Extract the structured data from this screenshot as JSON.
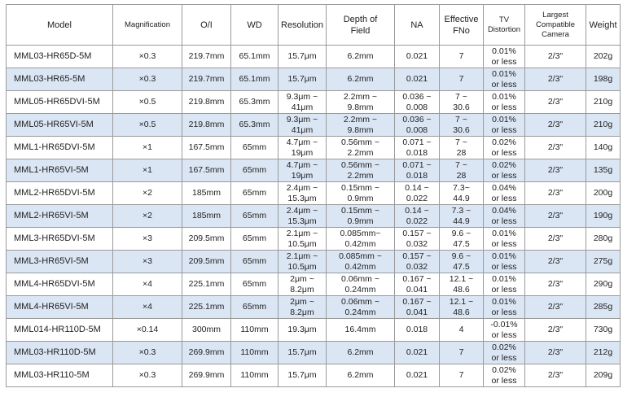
{
  "headers": {
    "model": "Model",
    "magnification": "Magnification",
    "oi": "O/I",
    "wd": "WD",
    "resolution": "Resolution",
    "dof": "Depth of\nField",
    "na": "NA",
    "fno": "Effective\nFNo",
    "tv": "TV\nDistortion",
    "camera": "Largest\nCompatible\nCamera",
    "weight": "Weight"
  },
  "rows": [
    {
      "model": "MML03-HR65D-5M",
      "mag": "×0.3",
      "oi": "219.7mm",
      "wd": "65.1mm",
      "res": "15.7μm",
      "dof": "6.2mm",
      "na": "0.021",
      "fno": "7",
      "tv": "0.01%\nor less",
      "cam": "2/3\"",
      "wt": "202g"
    },
    {
      "model": "MML03-HR65-5M",
      "mag": "×0.3",
      "oi": "219.7mm",
      "wd": "65.1mm",
      "res": "15.7μm",
      "dof": "6.2mm",
      "na": "0.021",
      "fno": "7",
      "tv": "0.01%\nor less",
      "cam": "2/3\"",
      "wt": "198g"
    },
    {
      "model": "MML05-HR65DVI-5M",
      "mag": "×0.5",
      "oi": "219.8mm",
      "wd": "65.3mm",
      "res": "9.3μm ~\n41μm",
      "dof": "2.2mm ~\n9.8mm",
      "na": "0.036 ~\n0.008",
      "fno": "7 ~\n30.6",
      "tv": "0.01%\nor less",
      "cam": "2/3\"",
      "wt": "210g"
    },
    {
      "model": "MML05-HR65VI-5M",
      "mag": "×0.5",
      "oi": "219.8mm",
      "wd": "65.3mm",
      "res": "9.3μm ~\n41μm",
      "dof": "2.2mm ~\n9.8mm",
      "na": "0.036 ~\n0.008",
      "fno": "7 ~\n30.6",
      "tv": "0.01%\nor less",
      "cam": "2/3\"",
      "wt": "210g"
    },
    {
      "model": "MML1-HR65DVI-5M",
      "mag": "×1",
      "oi": "167.5mm",
      "wd": "65mm",
      "res": "4.7μm ~\n19μm",
      "dof": "0.56mm ~\n2.2mm",
      "na": "0.071 ~\n0.018",
      "fno": "7 ~\n28",
      "tv": "0.02%\nor less",
      "cam": "2/3\"",
      "wt": "140g"
    },
    {
      "model": "MML1-HR65VI-5M",
      "mag": "×1",
      "oi": "167.5mm",
      "wd": "65mm",
      "res": "4.7μm ~\n19μm",
      "dof": "0.56mm ~\n2.2mm",
      "na": "0.071 ~\n0.018",
      "fno": "7 ~\n28",
      "tv": "0.02%\nor less",
      "cam": "2/3\"",
      "wt": "135g"
    },
    {
      "model": "MML2-HR65DVI-5M",
      "mag": "×2",
      "oi": "185mm",
      "wd": "65mm",
      "res": "2.4μm ~\n15.3μm",
      "dof": "0.15mm ~\n0.9mm",
      "na": "0.14 ~\n0.022",
      "fno": "7.3~\n44.9",
      "tv": "0.04%\nor less",
      "cam": "2/3\"",
      "wt": "200g"
    },
    {
      "model": "MML2-HR65VI-5M",
      "mag": "×2",
      "oi": "185mm",
      "wd": "65mm",
      "res": "2.4μm ~\n15.3μm",
      "dof": "0.15mm ~\n0.9mm",
      "na": "0.14 ~\n0.022",
      "fno": "7.3 ~\n44.9",
      "tv": "0.04%\nor less",
      "cam": "2/3\"",
      "wt": "190g"
    },
    {
      "model": "MML3-HR65DVI-5M",
      "mag": "×3",
      "oi": "209.5mm",
      "wd": "65mm",
      "res": "2.1μm ~\n10.5μm",
      "dof": "0.085mm~\n0.42mm",
      "na": "0.157 ~\n0.032",
      "fno": "9.6 ~\n47.5",
      "tv": "0.01%\nor less",
      "cam": "2/3\"",
      "wt": "280g"
    },
    {
      "model": "MML3-HR65VI-5M",
      "mag": "×3",
      "oi": "209.5mm",
      "wd": "65mm",
      "res": "2.1μm ~\n10.5μm",
      "dof": "0.085mm ~\n0.42mm",
      "na": "0.157 ~\n0.032",
      "fno": "9.6 ~\n47.5",
      "tv": "0.01%\nor less",
      "cam": "2/3\"",
      "wt": "275g"
    },
    {
      "model": "MML4-HR65DVI-5M",
      "mag": "×4",
      "oi": "225.1mm",
      "wd": "65mm",
      "res": "2μm ~\n8.2μm",
      "dof": "0.06mm ~\n0.24mm",
      "na": "0.167 ~\n0.041",
      "fno": "12.1 ~\n48.6",
      "tv": "0.01%\nor less",
      "cam": "2/3\"",
      "wt": "290g"
    },
    {
      "model": "MML4-HR65VI-5M",
      "mag": "×4",
      "oi": "225.1mm",
      "wd": "65mm",
      "res": "2μm ~\n8.2μm",
      "dof": "0.06mm ~\n0.24mm",
      "na": "0.167 ~\n0.041",
      "fno": "12.1 ~\n48.6",
      "tv": "0.01%\nor less",
      "cam": "2/3\"",
      "wt": "285g"
    },
    {
      "model": "MML014-HR110D-5M",
      "mag": "×0.14",
      "oi": "300mm",
      "wd": "110mm",
      "res": "19.3μm",
      "dof": "16.4mm",
      "na": "0.018",
      "fno": "4",
      "tv": "-0.01%\nor less",
      "cam": "2/3\"",
      "wt": "730g"
    },
    {
      "model": "MML03-HR110D-5M",
      "mag": "×0.3",
      "oi": "269.9mm",
      "wd": "110mm",
      "res": "15.7μm",
      "dof": "6.2mm",
      "na": "0.021",
      "fno": "7",
      "tv": "0.02%\nor less",
      "cam": "2/3\"",
      "wt": "212g"
    },
    {
      "model": "MML03-HR110-5M",
      "mag": "×0.3",
      "oi": "269.9mm",
      "wd": "110mm",
      "res": "15.7μm",
      "dof": "6.2mm",
      "na": "0.021",
      "fno": "7",
      "tv": "0.02%\nor less",
      "cam": "2/3\"",
      "wt": "209g"
    }
  ]
}
